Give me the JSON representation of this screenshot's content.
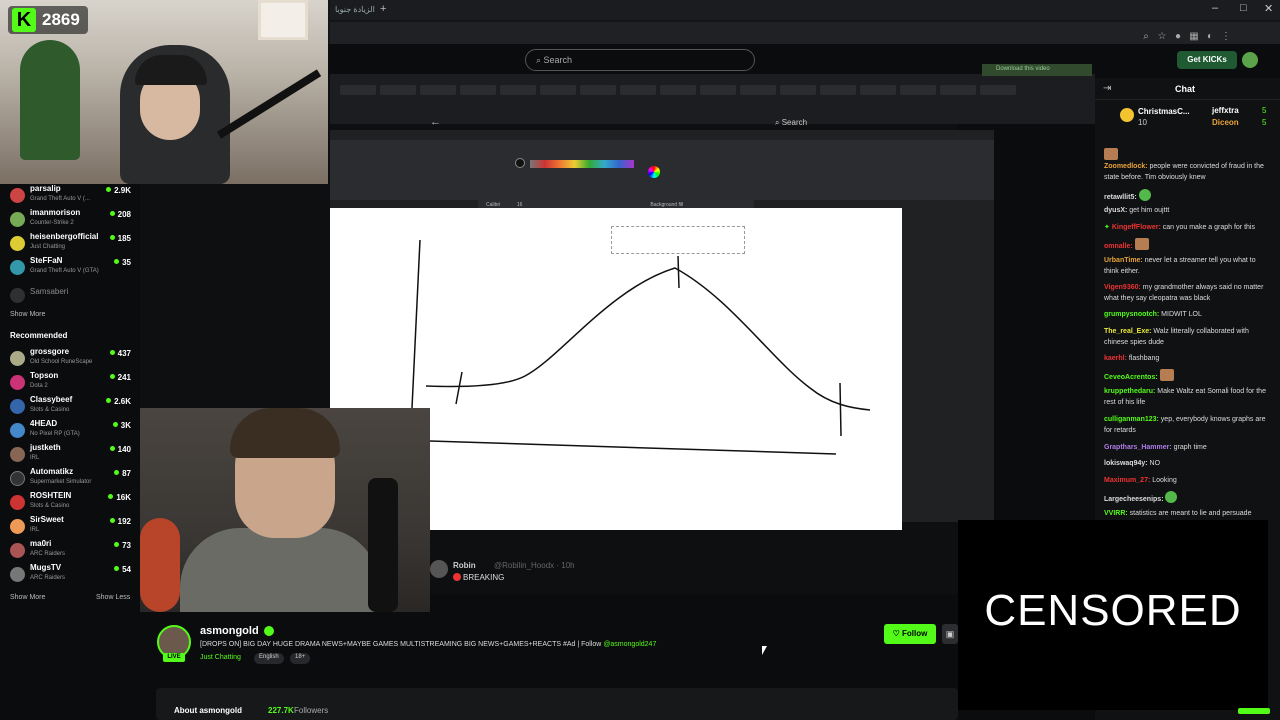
{
  "stream_overlay": {
    "logo_letter": "K",
    "viewers": "2869"
  },
  "browser": {
    "new_tab": "+",
    "tab_title": "الزيادة جنوبا",
    "min": "–",
    "max": "□",
    "close": "✕",
    "download_btn": "Download this video"
  },
  "kick_header": {
    "search_placeholder": "Search",
    "get_kicks": "Get KICKs"
  },
  "sidebar": {
    "following": [
      {
        "name": "parsalip",
        "category": "Grand Theft Auto V (...",
        "viewers": "2.9K",
        "color": "#c44"
      },
      {
        "name": "imanmorison",
        "category": "Counter-Strike 2",
        "viewers": "208",
        "color": "#7a5"
      },
      {
        "name": "heisenbergofficial",
        "category": "Just Chatting",
        "viewers": "185",
        "color": "#dc3"
      },
      {
        "name": "SteFFaN",
        "category": "Grand Theft Auto V (GTA)",
        "viewers": "35",
        "color": "#39a"
      },
      {
        "name": "Samsaberi",
        "category": "",
        "viewers": "",
        "color": "#555"
      }
    ],
    "show_more_1": "Show More",
    "recommended_title": "Recommended",
    "recommended": [
      {
        "name": "grossgore",
        "category": "Old School RuneScape",
        "viewers": "437",
        "color": "#aa8"
      },
      {
        "name": "Topson",
        "category": "Dota 2",
        "viewers": "241",
        "color": "#c37"
      },
      {
        "name": "Classybeef",
        "category": "Slots & Casino",
        "viewers": "2.6K",
        "color": "#36a"
      },
      {
        "name": "4HEAD",
        "category": "No Pixel RP (GTA)",
        "viewers": "3K",
        "color": "#48c"
      },
      {
        "name": "justketh",
        "category": "IRL",
        "viewers": "140",
        "color": "#865"
      },
      {
        "name": "Automatikz",
        "category": "Supermarket Simulator",
        "viewers": "87",
        "color": "#333"
      },
      {
        "name": "ROSHTEIN",
        "category": "Slots & Casino",
        "viewers": "16K",
        "color": "#c33"
      },
      {
        "name": "SirSweet",
        "category": "IRL",
        "viewers": "192",
        "color": "#e95"
      },
      {
        "name": "ma0ri",
        "category": "ARC Raiders",
        "viewers": "73",
        "color": "#a55"
      },
      {
        "name": "MugsTV",
        "category": "ARC Raiders",
        "viewers": "54",
        "color": "#777"
      }
    ],
    "show_more_2": "Show More",
    "show_less": "Show Less"
  },
  "x_page": {
    "search": "Search",
    "back": "←",
    "tweet_name": "Robin",
    "tweet_handle": "@Robilin_Hoodx · 10h",
    "tweet_text": "BREAKING"
  },
  "paint": {
    "font": "Calibri",
    "size": "16",
    "background_fill": "Background fill"
  },
  "channel": {
    "name": "asmongold",
    "live": "LIVE",
    "title": "[DROPS ON] BIG DAY HUGE DRAMA NEWS+MAYBE GAMES MULTISTREAMING BIG NEWS+GAMES+REACTS #Ad | Follow",
    "title_tag": "@asmongold247",
    "category": "Just Chatting",
    "tags": [
      "English",
      "18+"
    ],
    "follow": "Follow",
    "about_label": "About asmongold",
    "followers_count": "227.7K",
    "followers_label": "Followers"
  },
  "chat": {
    "title": "Chat",
    "pinned": [
      {
        "name": "ChristmasC...",
        "count": "10"
      },
      {
        "name": "jeffxtra",
        "count": "5"
      },
      {
        "name": "Diceon",
        "count": "5"
      }
    ],
    "messages": [
      {
        "user": "",
        "color": "#c66",
        "text": "",
        "emote": "brown"
      },
      {
        "user": "Zoomedlock:",
        "color": "#e9a33a",
        "text": " people were convicted of fraud in the state before. Tim obviously knew",
        "emote": ""
      },
      {
        "user": "retawllit5:",
        "color": "#ddd",
        "text": "",
        "emote": "green"
      },
      {
        "user": "dyusX:",
        "color": "#ddd",
        "text": " get him oujttt",
        "emote": ""
      },
      {
        "user": "KingeffFlower:",
        "color": "#e33",
        "text": " can you make a graph for this",
        "emote": ""
      },
      {
        "user": "omnalle:",
        "color": "#e33",
        "text": "",
        "emote": "brown"
      },
      {
        "user": "UrbanTime:",
        "color": "#e9a33a",
        "text": " never let a streamer tell you what to think either.",
        "emote": ""
      },
      {
        "user": "Vigen9360:",
        "color": "#e33",
        "text": " my grandmother always said no matter what they say cleopatra was black",
        "emote": ""
      },
      {
        "user": "grumpysnootch:",
        "color": "#53fc18",
        "text": " MIDWIT LOL",
        "emote": ""
      },
      {
        "user": "The_real_Exe:",
        "color": "#e9e93a",
        "text": " Walz litterally collaborated with chinese spies dude",
        "emote": ""
      },
      {
        "user": "kaerhl:",
        "color": "#e33",
        "text": " flashbang",
        "emote": ""
      },
      {
        "user": "CeveoAcrentos:",
        "color": "#53fc18",
        "text": "",
        "emote": "brown"
      },
      {
        "user": "kruppethedaru:",
        "color": "#53fc18",
        "text": " Make Waltz eat Somali food for the rest of his life",
        "emote": ""
      },
      {
        "user": "culliganman123:",
        "color": "#53fc18",
        "text": " yep, everybody knows graphs are for retards",
        "emote": ""
      },
      {
        "user": "Grapthars_Hammer:",
        "color": "#b07be8",
        "text": " graph time",
        "emote": ""
      },
      {
        "user": "lokiswaq94y:",
        "color": "#ddd",
        "text": " NO",
        "emote": ""
      },
      {
        "user": "Maximum_27:",
        "color": "#e33",
        "text": " Looking",
        "emote": ""
      },
      {
        "user": "Largecheesenips:",
        "color": "#ddd",
        "text": "",
        "emote": "green"
      },
      {
        "user": "VVIRR:",
        "color": "#53fc18",
        "text": " statistics are meant to lie and persuade",
        "emote": ""
      }
    ]
  },
  "censor": {
    "text": "CENSORED"
  }
}
